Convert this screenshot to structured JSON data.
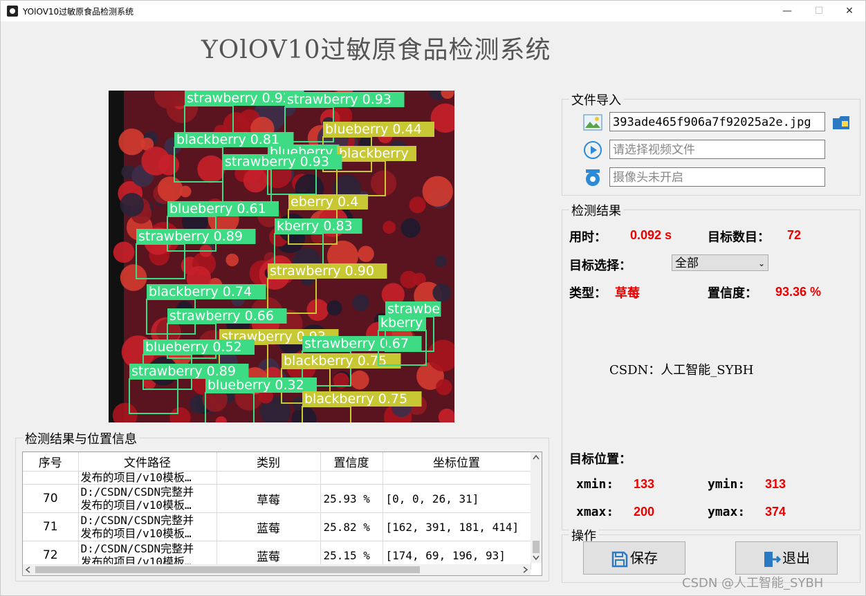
{
  "window": {
    "title": "YOlOV10过敏原食品检测系统",
    "minimize": "—",
    "maximize": "☐",
    "close": "✕"
  },
  "header": {
    "title": "YOlOV10过敏原食品检测系统"
  },
  "image": {
    "labels": [
      "strawberry 0.93",
      "strawberry 0.93",
      "blueberry 0.44",
      "blackberry 0.81",
      "blueberry",
      "blackberry",
      "strawberry 0.93",
      "blueberry 0.61",
      "eberry 0.4",
      "kberry 0.83",
      "strawberry 0.89",
      "strawberry 0.90",
      "blackberry 0.74",
      "strawberry 0.66",
      "strawberry 0.93",
      "blueberry 0.52",
      "strawberry 0.67",
      "blackberry 0.75",
      "strawberry 0.89",
      "blueberry 0.32",
      "blackberry 0.75",
      "strawbe",
      "kberry"
    ]
  },
  "file_import": {
    "title": "文件导入",
    "image_path": "393ade465f906a7f92025a2e.jpg",
    "video_placeholder": "请选择视频文件",
    "camera_placeholder": "摄像头未开启"
  },
  "results": {
    "title": "检测结果",
    "time_label": "用时：",
    "time_value": "0.092 s",
    "count_label": "目标数目：",
    "count_value": "72",
    "select_label": "目标选择：",
    "select_value": "全部",
    "type_label": "类型：",
    "type_value": "草莓",
    "conf_label": "置信度：",
    "conf_value": "93.36 %",
    "credit": "CSDN：人工智能_SYBH",
    "pos_label": "目标位置：",
    "xmin_label": "xmin:",
    "xmin": "133",
    "ymin_label": "ymin:",
    "ymin": "313",
    "xmax_label": "xmax:",
    "xmax": "200",
    "ymax_label": "ymax:",
    "ymax": "374"
  },
  "ops": {
    "title": "操作",
    "save": "保存",
    "exit": "退出"
  },
  "table": {
    "title": "检测结果与位置信息",
    "headers": [
      "序号",
      "文件路径",
      "类别",
      "置信度",
      "坐标位置"
    ],
    "rows": [
      {
        "idx": "70",
        "path1": "D:/CSDN/CSDN完整并",
        "path2": "发布的项目/v10模板…",
        "cls": "草莓",
        "conf": "25.93 %",
        "pos": "[0, 0, 26, 31]"
      },
      {
        "idx": "71",
        "path1": "D:/CSDN/CSDN完整并",
        "path2": "发布的项目/v10模板…",
        "cls": "蓝莓",
        "conf": "25.82 %",
        "pos": "[162, 391, 181, 414]"
      },
      {
        "idx": "72",
        "path1": "D:/CSDN/CSDN完整并",
        "path2": "发布的项目/v10模板…",
        "cls": "蓝莓",
        "conf": "25.15 %",
        "pos": "[174, 69, 196, 93]"
      }
    ],
    "partial_path": "发布的项目/v10模板…"
  },
  "watermark": "CSDN @人工智能_SYBH"
}
